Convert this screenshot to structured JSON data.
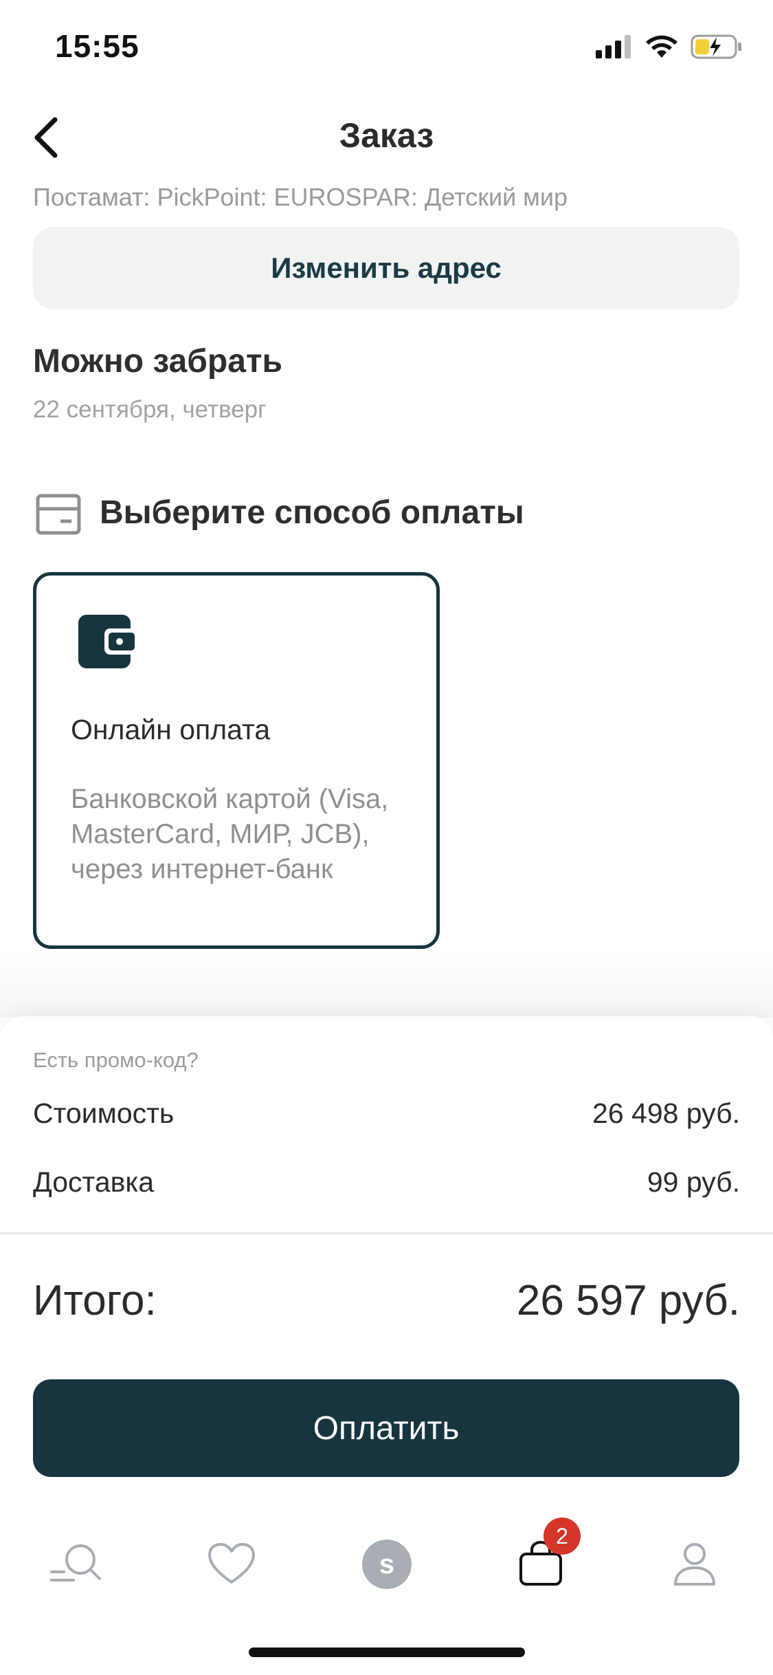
{
  "status_bar": {
    "time": "15:55"
  },
  "header": {
    "title": "Заказ"
  },
  "delivery": {
    "address": "Постамат: PickPoint: EUROSPAR: Детский мир",
    "change_address_label": "Изменить адрес",
    "pickup_title": "Можно забрать",
    "pickup_date": "22 сентября, четверг"
  },
  "payment": {
    "section_title": "Выберите способ оплаты",
    "option_title": "Онлайн оплата",
    "option_description": "Банковской картой (Visa, MasterCard, МИР, JCB), через интернет-банк"
  },
  "summary": {
    "promo_link": "Есть промо-код?",
    "cost_label": "Стоимость",
    "cost_value": "26 498 руб.",
    "delivery_label": "Доставка",
    "delivery_value": "99 руб.",
    "total_label": "Итого:",
    "total_value": "26 597 руб.",
    "pay_button": "Оплатить"
  },
  "tabbar": {
    "items": [
      {
        "name": "search",
        "icon": "search-icon"
      },
      {
        "name": "favorites",
        "icon": "heart-icon"
      },
      {
        "name": "spar",
        "icon": "brand-s-icon",
        "glyph": "s"
      },
      {
        "name": "cart",
        "icon": "cart-bag-icon",
        "badge": "2"
      },
      {
        "name": "profile",
        "icon": "user-icon"
      }
    ]
  },
  "colors": {
    "accent": "#17353f",
    "badge": "#d6362a",
    "muted_text": "#9a9a9a",
    "button_bg_light": "#f1f3f3"
  }
}
